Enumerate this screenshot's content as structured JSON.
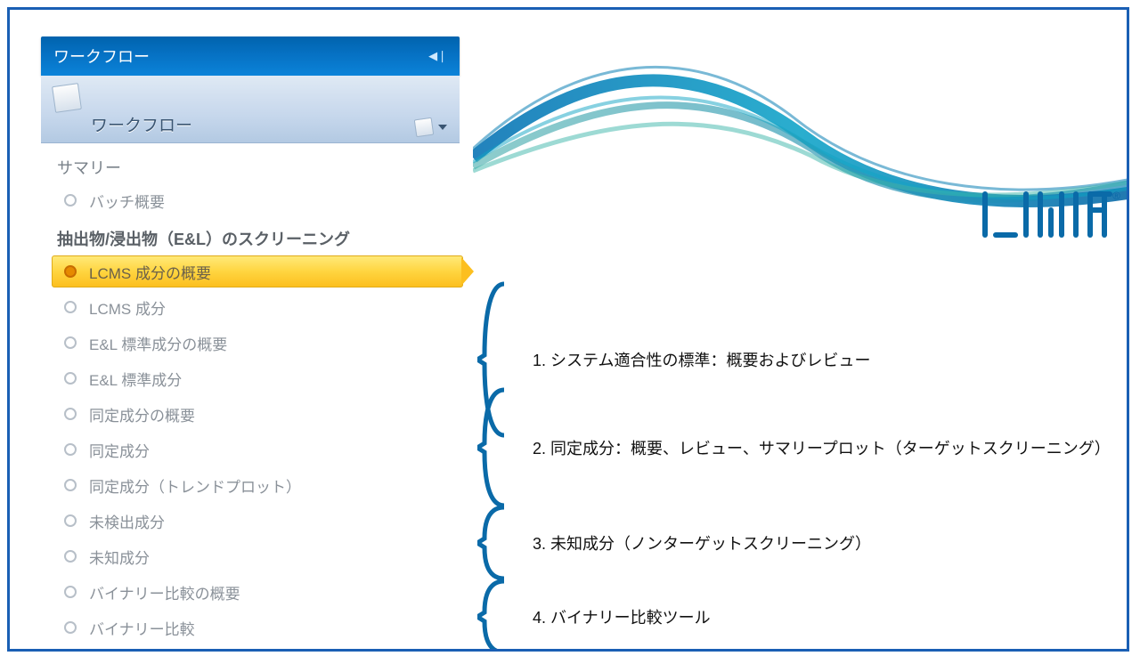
{
  "brand": {
    "name": "UNIFI"
  },
  "panel": {
    "header": "ワークフロー",
    "sub_header": "ワークフロー"
  },
  "sections": {
    "summary": {
      "title": "サマリー",
      "items": [
        "バッチ概要"
      ]
    },
    "el": {
      "title": "抽出物/浸出物（E&L）のスクリーニング",
      "items": [
        "LCMS 成分の概要",
        "LCMS 成分",
        "E&L 標準成分の概要",
        "E&L 標準成分",
        "同定成分の概要",
        "同定成分",
        "同定成分（トレンドプロット）",
        "未検出成分",
        "未知成分",
        "バイナリー比較の概要",
        "バイナリー比較"
      ],
      "selected_index": 0
    }
  },
  "annotations": [
    "1. システム適合性の標準：概要およびレビュー",
    "2. 同定成分：概要、レビュー、サマリープロット（ターゲットスクリーニング）",
    "3. 未知成分（ノンターゲットスクリーニング）",
    "4. バイナリー比較ツール"
  ]
}
